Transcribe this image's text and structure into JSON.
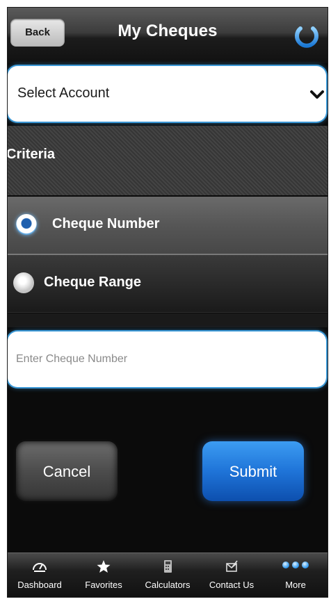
{
  "header": {
    "back_label": "Back",
    "title": "My Cheques",
    "power_icon": "power-icon"
  },
  "account_select": {
    "selected": "Select Account",
    "icon": "chevron-down-icon"
  },
  "criteria": {
    "label": "Criteria",
    "options": [
      {
        "label": "Cheque Number",
        "selected": true
      },
      {
        "label": "Cheque Range",
        "selected": false
      }
    ]
  },
  "cheque_input": {
    "placeholder": "Enter Cheque Number",
    "value": ""
  },
  "actions": {
    "cancel_label": "Cancel",
    "submit_label": "Submit"
  },
  "tabbar": {
    "items": [
      {
        "label": "Dashboard",
        "icon": "dashboard-gauge-icon"
      },
      {
        "label": "Favorites",
        "icon": "star-icon"
      },
      {
        "label": "Calculators",
        "icon": "calculator-icon"
      },
      {
        "label": "Contact Us",
        "icon": "contact-envelope-icon"
      },
      {
        "label": "More",
        "icon": "more-dots-icon"
      }
    ]
  },
  "colors": {
    "accent": "#3b98d6",
    "submit": "#1f74d8",
    "background": "#0b0b0b"
  }
}
